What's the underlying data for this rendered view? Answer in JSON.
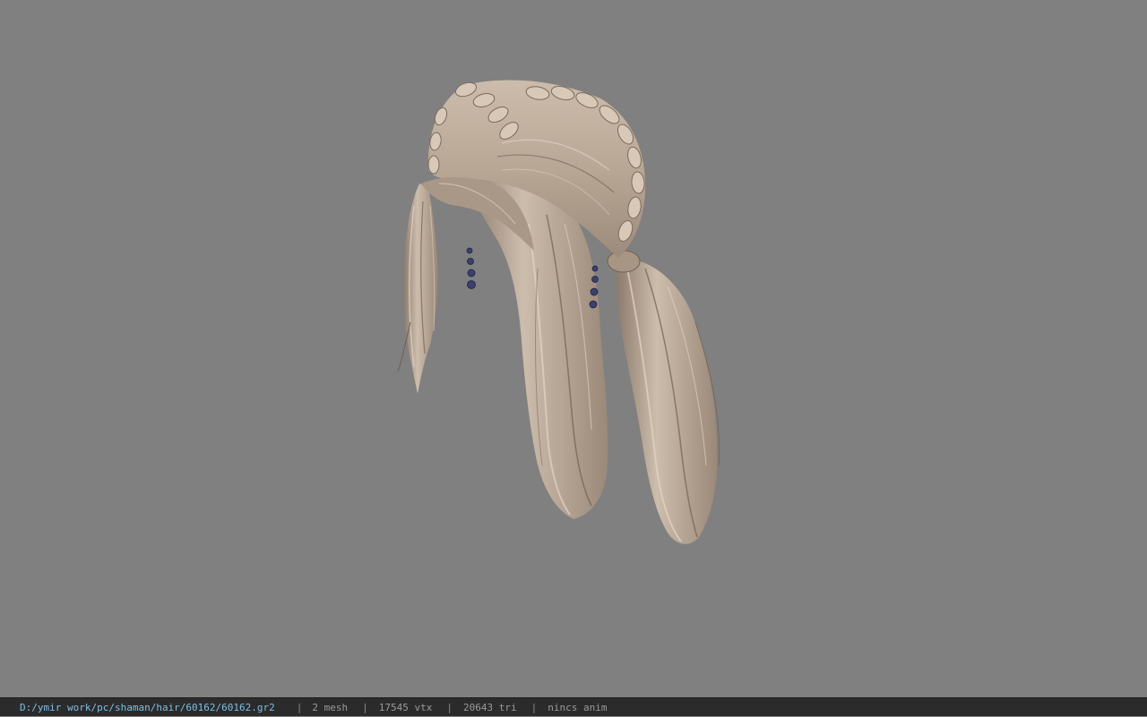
{
  "viewport": {
    "background": "#808080",
    "model": {
      "hair_base": "#b9a796",
      "hair_light": "#e2d4c6",
      "hair_shadow": "#6e5f52",
      "jewel": "#3a4070"
    }
  },
  "statusbar": {
    "file_path": "D:/ymir work/pc/shaman/hair/60162/60162.gr2",
    "separator": "|",
    "mesh": "2 mesh",
    "vtx": "17545 vtx",
    "tri": "20643 tri",
    "anim": "nincs anim"
  }
}
